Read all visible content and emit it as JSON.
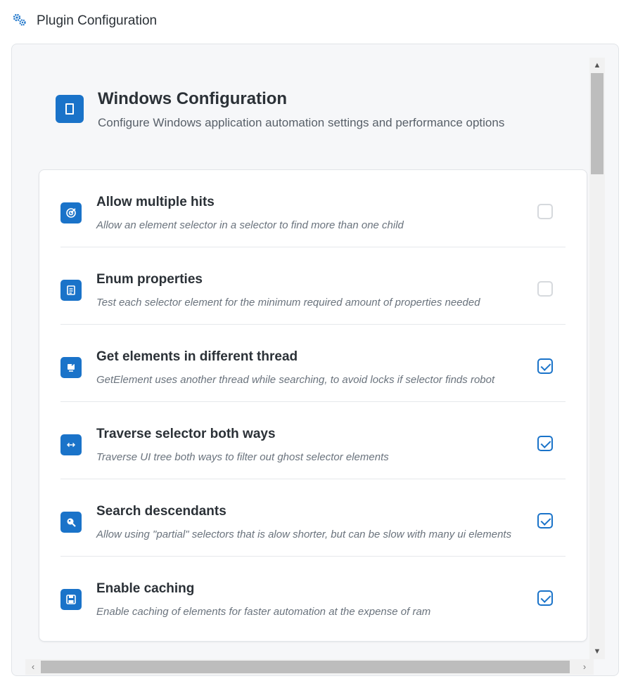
{
  "header": {
    "title": "Plugin Configuration",
    "icon": "gears-icon"
  },
  "section": {
    "title": "Windows Configuration",
    "subtitle": "Configure Windows application automation settings and performance options",
    "icon": "window-icon"
  },
  "options": [
    {
      "title": "Allow multiple hits",
      "description": "Allow an element selector in a selector to find more than one child",
      "checked": false,
      "icon": "target-icon"
    },
    {
      "title": "Enum properties",
      "description": "Test each selector element for the minimum required amount of properties needed",
      "checked": false,
      "icon": "list-icon"
    },
    {
      "title": "Get elements in different thread",
      "description": "GetElement uses another thread while searching, to avoid locks if selector finds robot",
      "checked": true,
      "icon": "thread-icon"
    },
    {
      "title": "Traverse selector both ways",
      "description": "Traverse UI tree both ways to filter out ghost selector elements",
      "checked": true,
      "icon": "arrows-horizontal-icon"
    },
    {
      "title": "Search descendants",
      "description": "Allow using \"partial\" selectors that is alow shorter, but can be slow with many ui elements",
      "checked": true,
      "icon": "magnifier-icon"
    },
    {
      "title": "Enable caching",
      "description": "Enable caching of elements for faster automation at the expense of ram",
      "checked": true,
      "icon": "floppy-disk-icon"
    }
  ],
  "colors": {
    "accent": "#1a73c9"
  }
}
